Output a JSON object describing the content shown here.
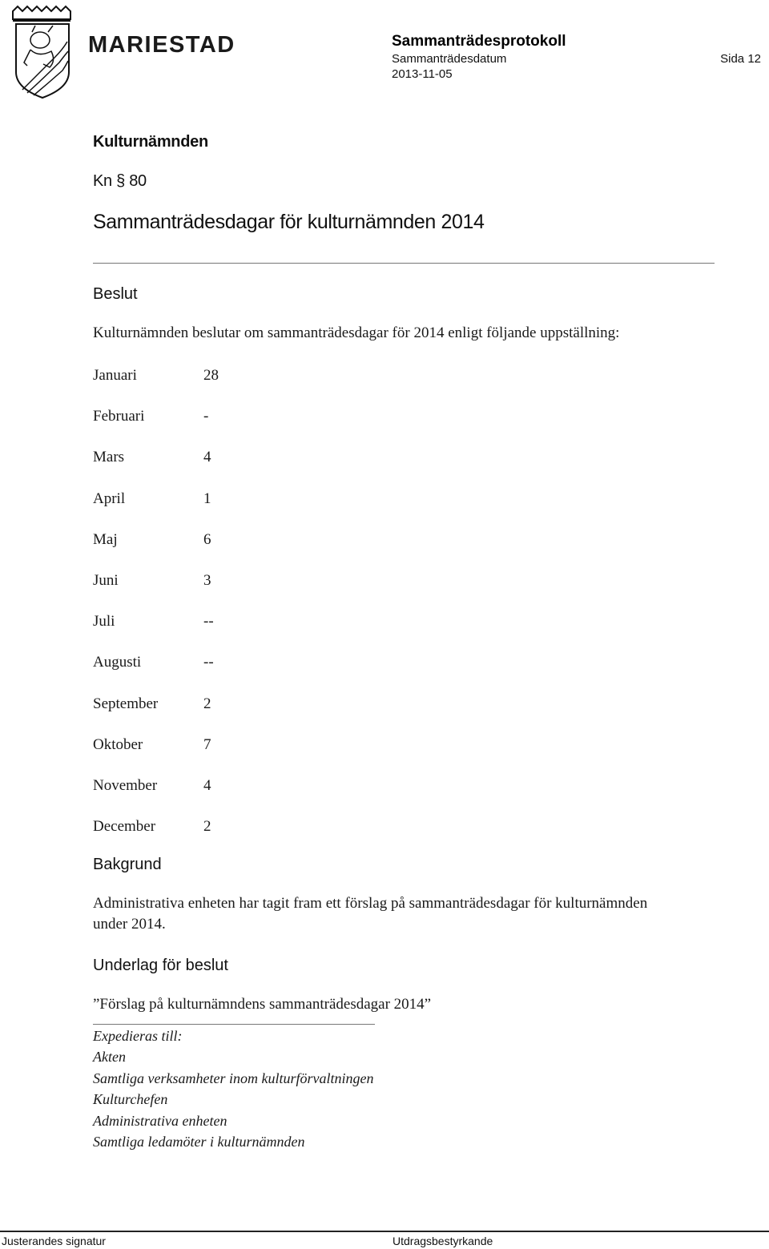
{
  "header": {
    "logo_text": "MARIESTAD",
    "logo_crest": "municipal-coat-of-arms-bull",
    "title": "Sammanträdesprotokoll",
    "date_label": "Sammanträdesdatum",
    "date": "2013-11-05",
    "page": "Sida 12"
  },
  "committee": "Kulturnämnden",
  "paragraph": "Kn § 80",
  "doc_title": "Sammanträdesdagar för kulturnämnden 2014",
  "decision": {
    "heading": "Beslut",
    "text": "Kulturnämnden beslutar om sammanträdesdagar för 2014 enligt följande uppställning:",
    "schedule": [
      {
        "month": "Januari",
        "day": "28"
      },
      {
        "month": "Februari",
        "day": "-"
      },
      {
        "month": "Mars",
        "day": "4"
      },
      {
        "month": "April",
        "day": "1"
      },
      {
        "month": "Maj",
        "day": "6"
      },
      {
        "month": "Juni",
        "day": "3"
      },
      {
        "month": "Juli",
        "day": "--"
      },
      {
        "month": "Augusti",
        "day": "--"
      },
      {
        "month": "September",
        "day": "2"
      },
      {
        "month": "Oktober",
        "day": "7"
      },
      {
        "month": "November",
        "day": "4"
      },
      {
        "month": "December",
        "day": "2"
      }
    ]
  },
  "background": {
    "heading": "Bakgrund",
    "text_line1": "Administrativa enheten har tagit fram ett förslag på sammanträdesdagar för kulturnämnden",
    "text_line2": "under 2014."
  },
  "basis": {
    "heading": "Underlag för beslut",
    "item": "”Förslag på kulturnämndens sammanträdesdagar 2014”"
  },
  "distribution": {
    "heading": "Expedieras till:",
    "recipients": [
      "Akten",
      "Samtliga verksamheter inom kulturförvaltningen",
      "Kulturchefen",
      "Administrativa enheten",
      "Samtliga ledamöter i kulturnämnden"
    ]
  },
  "footer": {
    "left": "Justerandes signatur",
    "right": "Utdragsbestyrkande"
  }
}
